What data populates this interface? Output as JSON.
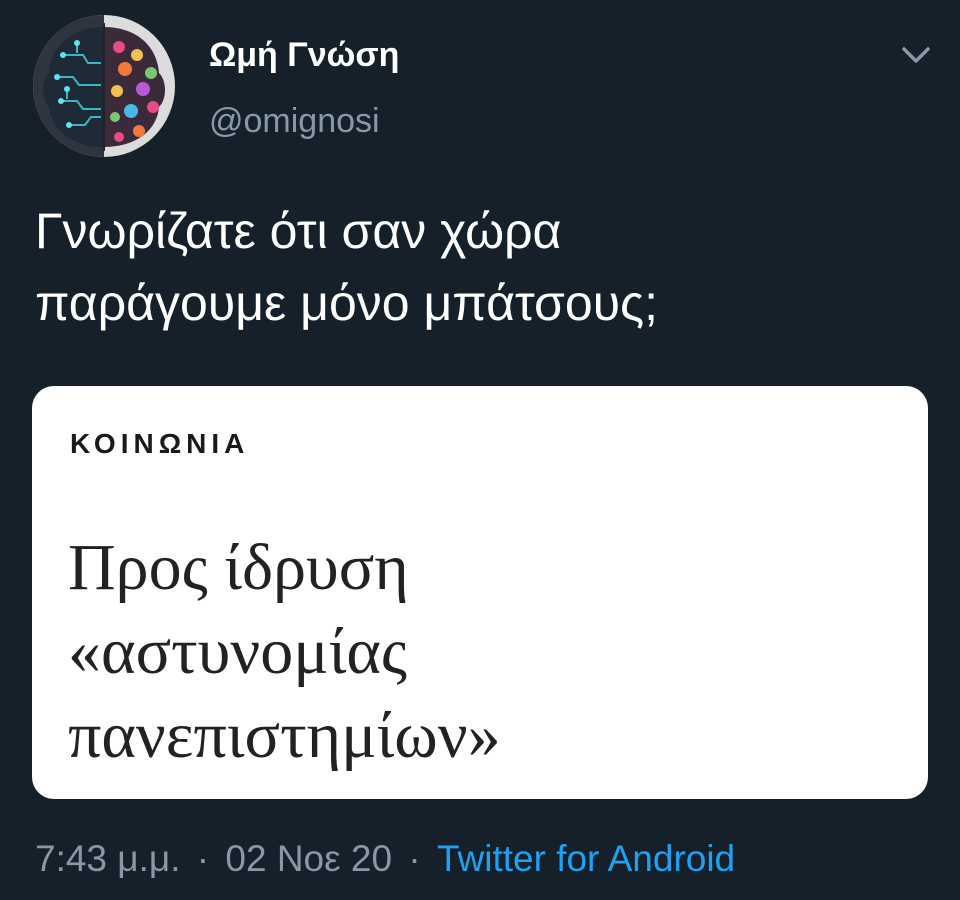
{
  "author": {
    "name": "Ωμή Γνώση",
    "handle": "@omignosi"
  },
  "tweet": {
    "text_line1": "Γνωρίζατε ότι σαν χώρα",
    "text_line2": "παράγουμε μόνο μπάτσους;"
  },
  "card": {
    "category": "ΚΟΙΝΩΝΙΑ",
    "headline_line1": "Προς ίδρυση",
    "headline_line2": "«αστυνομίας",
    "headline_line3": "πανεπιστημίων»"
  },
  "meta": {
    "time": "7:43 μ.μ.",
    "separator": "·",
    "date": "02 Νοε 20",
    "source": "Twitter for Android"
  },
  "icons": {
    "menu": "chevron-down-icon"
  },
  "colors": {
    "background": "#15202b",
    "secondary_text": "#8899a6",
    "link": "#1da1f2",
    "card_background": "#ffffff"
  }
}
